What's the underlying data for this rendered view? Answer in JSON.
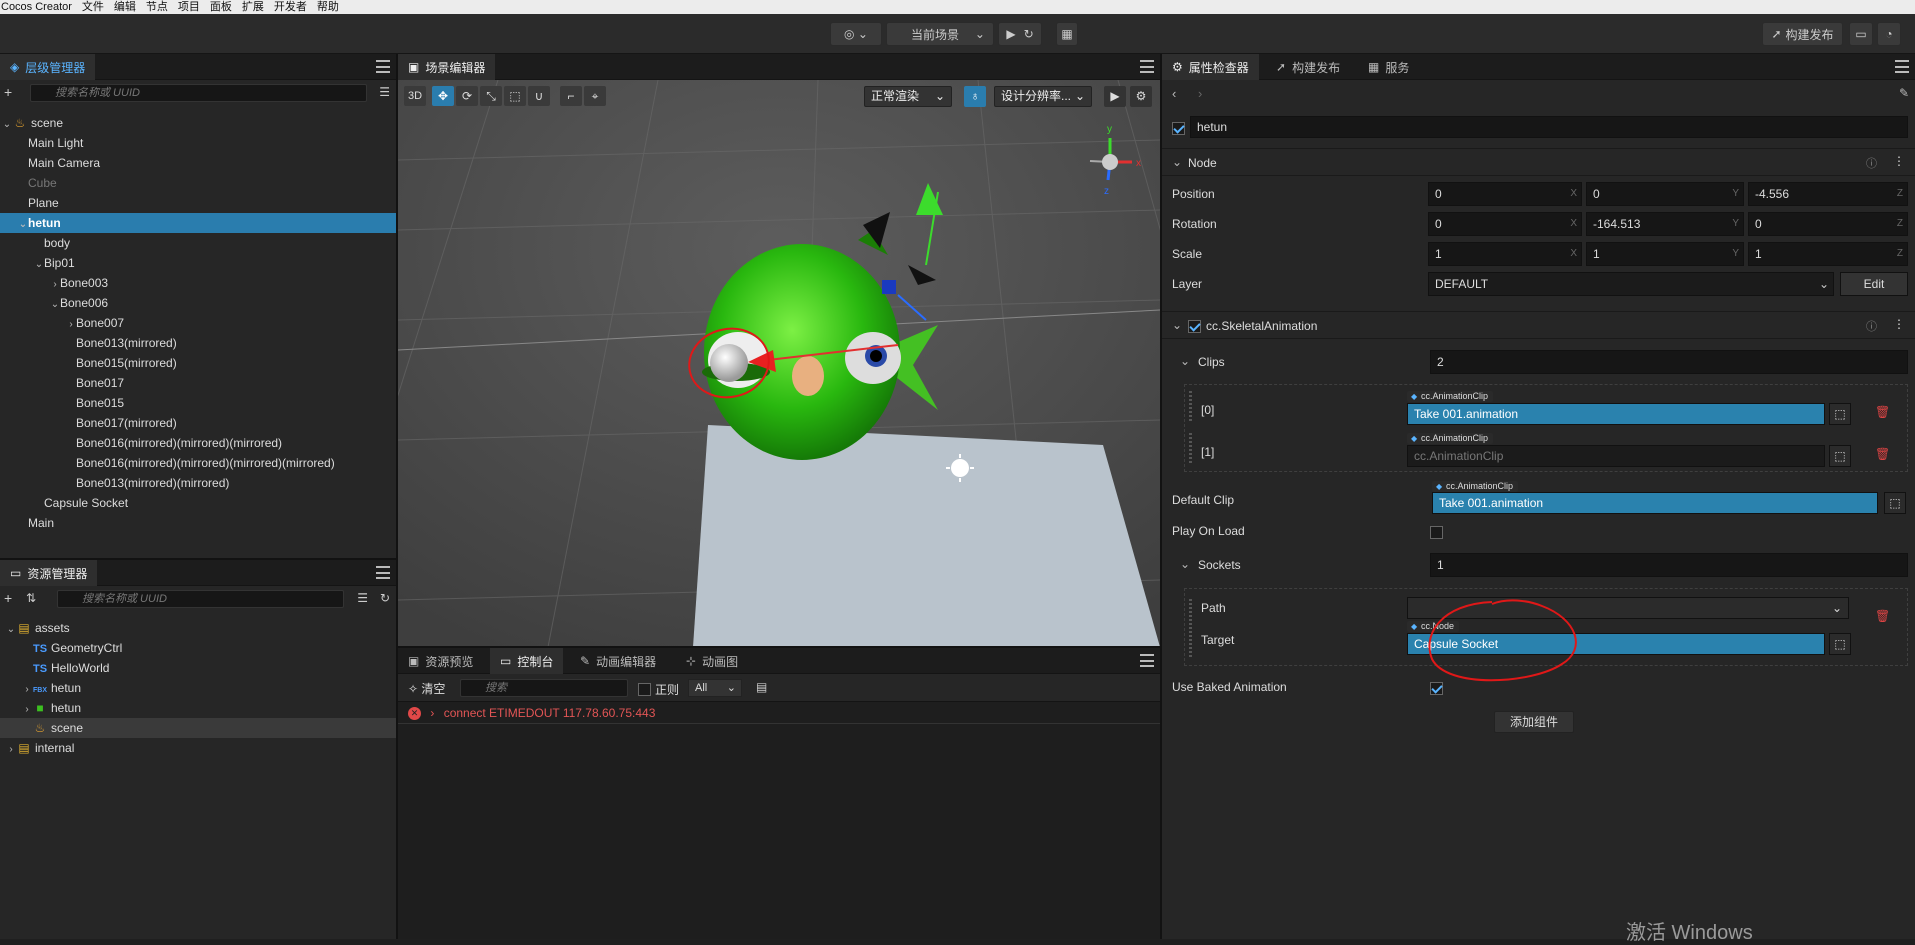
{
  "menubar": {
    "app": "Cocos Creator",
    "items": [
      "文件",
      "编辑",
      "节点",
      "项目",
      "面板",
      "扩展",
      "开发者",
      "帮助"
    ]
  },
  "toolbar": {
    "scene_select": "当前场景",
    "build_publish": "构建发布"
  },
  "hierarchy": {
    "tab": "层级管理器",
    "search_placeholder": "搜索名称或 UUID",
    "nodes": [
      {
        "label": "scene",
        "depth": 0,
        "arrow": "v",
        "icon": "scene-icon"
      },
      {
        "label": "Main Light",
        "depth": 1
      },
      {
        "label": "Main Camera",
        "depth": 1
      },
      {
        "label": "Cube",
        "depth": 1,
        "dim": true
      },
      {
        "label": "Plane",
        "depth": 1
      },
      {
        "label": "hetun",
        "depth": 1,
        "arrow": "v",
        "selected": true
      },
      {
        "label": "body",
        "depth": 2
      },
      {
        "label": "Bip01",
        "depth": 2,
        "arrow": "v"
      },
      {
        "label": "Bone003",
        "depth": 3,
        "arrow": ">"
      },
      {
        "label": "Bone006",
        "depth": 3,
        "arrow": "v"
      },
      {
        "label": "Bone007",
        "depth": 4,
        "arrow": ">"
      },
      {
        "label": "Bone013(mirrored)",
        "depth": 4
      },
      {
        "label": "Bone015(mirrored)",
        "depth": 4
      },
      {
        "label": "Bone017",
        "depth": 4
      },
      {
        "label": "Bone015",
        "depth": 4
      },
      {
        "label": "Bone017(mirrored)",
        "depth": 4
      },
      {
        "label": "Bone016(mirrored)(mirrored)(mirrored)",
        "depth": 4
      },
      {
        "label": "Bone016(mirrored)(mirrored)(mirrored)(mirrored)",
        "depth": 4
      },
      {
        "label": "Bone013(mirrored)(mirrored)",
        "depth": 4
      },
      {
        "label": "Capsule Socket",
        "depth": 2
      },
      {
        "label": "Main",
        "depth": 1
      }
    ]
  },
  "assets": {
    "tab": "资源管理器",
    "search_placeholder": "搜索名称或 UUID",
    "items": [
      {
        "label": "assets",
        "depth": 0,
        "arrow": "v",
        "icon": "db-icon"
      },
      {
        "label": "GeometryCtrl",
        "depth": 1,
        "icon": "ts-icon",
        "badge": "TS"
      },
      {
        "label": "HelloWorld",
        "depth": 1,
        "icon": "ts-icon",
        "badge": "TS"
      },
      {
        "label": "hetun",
        "depth": 1,
        "arrow": ">",
        "icon": "fbx-icon",
        "badge": "FBX"
      },
      {
        "label": "hetun",
        "depth": 1,
        "arrow": ">",
        "icon": "texture-icon"
      },
      {
        "label": "scene",
        "depth": 1,
        "icon": "scene-icon",
        "highlight": true
      },
      {
        "label": "internal",
        "depth": 0,
        "arrow": ">",
        "icon": "db-icon"
      }
    ]
  },
  "scene": {
    "tab": "场景编辑器",
    "mode": "3D",
    "render_mode": "正常渲染",
    "resolution": "设计分辨率...",
    "gizmo": {
      "x": "x",
      "y": "y",
      "z": "z"
    }
  },
  "console": {
    "tabs": [
      "资源预览",
      "控制台",
      "动画编辑器",
      "动画图"
    ],
    "clear": "清空",
    "search_placeholder": "搜索",
    "regex": "正则",
    "filter": "All",
    "log": "connect ETIMEDOUT 117.78.60.75:443"
  },
  "inspector": {
    "tabs": [
      "属性检查器",
      "构建发布",
      "服务"
    ],
    "node_name": "hetun",
    "node_section": "Node",
    "position": {
      "label": "Position",
      "x": "0",
      "y": "0",
      "z": "-4.556"
    },
    "rotation": {
      "label": "Rotation",
      "x": "0",
      "y": "-164.513",
      "z": "0"
    },
    "scale": {
      "label": "Scale",
      "x": "1",
      "y": "1",
      "z": "1"
    },
    "layer": {
      "label": "Layer",
      "value": "DEFAULT",
      "edit": "Edit"
    },
    "axes": {
      "x": "X",
      "y": "Y",
      "z": "Z"
    },
    "component": "cc.SkeletalAnimation",
    "clips": {
      "label": "Clips",
      "count": "2",
      "tag": "cc.AnimationClip",
      "items": [
        {
          "index": "[0]",
          "value": "Take 001.animation"
        },
        {
          "index": "[1]",
          "value": "cc.AnimationClip"
        }
      ]
    },
    "default_clip": {
      "label": "Default Clip",
      "tag": "cc.AnimationClip",
      "value": "Take 001.animation"
    },
    "play_on_load": "Play On Load",
    "sockets": {
      "label": "Sockets",
      "count": "1",
      "path": "Path",
      "target": "Target",
      "tag": "cc.Node",
      "target_value": "Capsule Socket"
    },
    "use_baked": "Use Baked Animation",
    "add_component": "添加组件"
  },
  "watermark": "激活 Windows"
}
